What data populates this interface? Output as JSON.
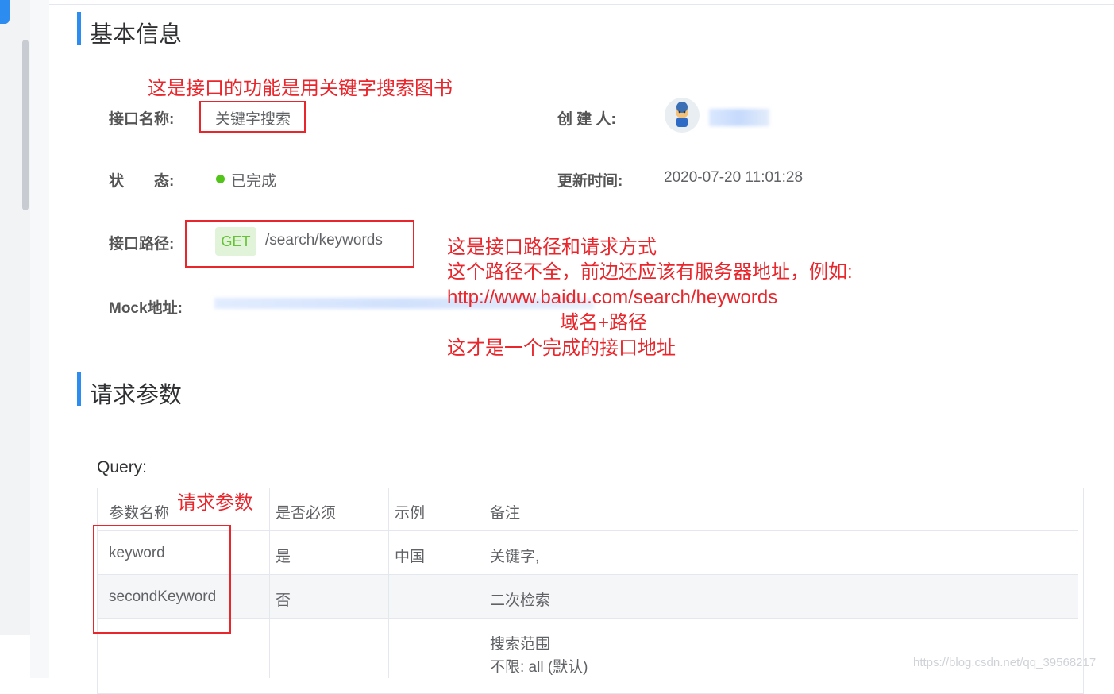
{
  "basic_info": {
    "title": "基本信息",
    "name_label": "接口名称:",
    "name_value": "关键字搜索",
    "creator_label": "创 建 人:",
    "status_label": "状　　态:",
    "status_value": "已完成",
    "updated_label": "更新时间:",
    "updated_value": "2020-07-20 11:01:28",
    "path_label": "接口路径:",
    "method": "GET",
    "path_value": "/search/keywords",
    "mock_label": "Mock地址:"
  },
  "annotations": {
    "name_note": "这是接口的功能是用关键字搜索图书",
    "path_note_1": "这是接口路径和请求方式",
    "path_note_2": "这个路径不全，前边还应该有服务器地址，例如:",
    "path_note_3": "http://www.baidu.com/search/heywords",
    "path_note_4": "域名+路径",
    "path_note_5": "这才是一个完成的接口地址",
    "param_note": "请求参数"
  },
  "request_params": {
    "title": "请求参数",
    "query_label": "Query:",
    "columns": [
      "参数名称",
      "是否必须",
      "示例",
      "备注"
    ],
    "rows": [
      {
        "name": "keyword",
        "required": "是",
        "example": "中国",
        "note": "关键字,"
      },
      {
        "name": "secondKeyword",
        "required": "否",
        "example": "",
        "note": "二次检索"
      },
      {
        "name": "",
        "required": "",
        "example": "",
        "note": "搜索范围",
        "note2": "不限: all (默认)"
      }
    ]
  },
  "watermark": "https://blog.csdn.net/qq_39568217",
  "colors": {
    "accent": "#2d8cf0",
    "annotation": "#e8262b",
    "status_ok": "#52c41a"
  }
}
